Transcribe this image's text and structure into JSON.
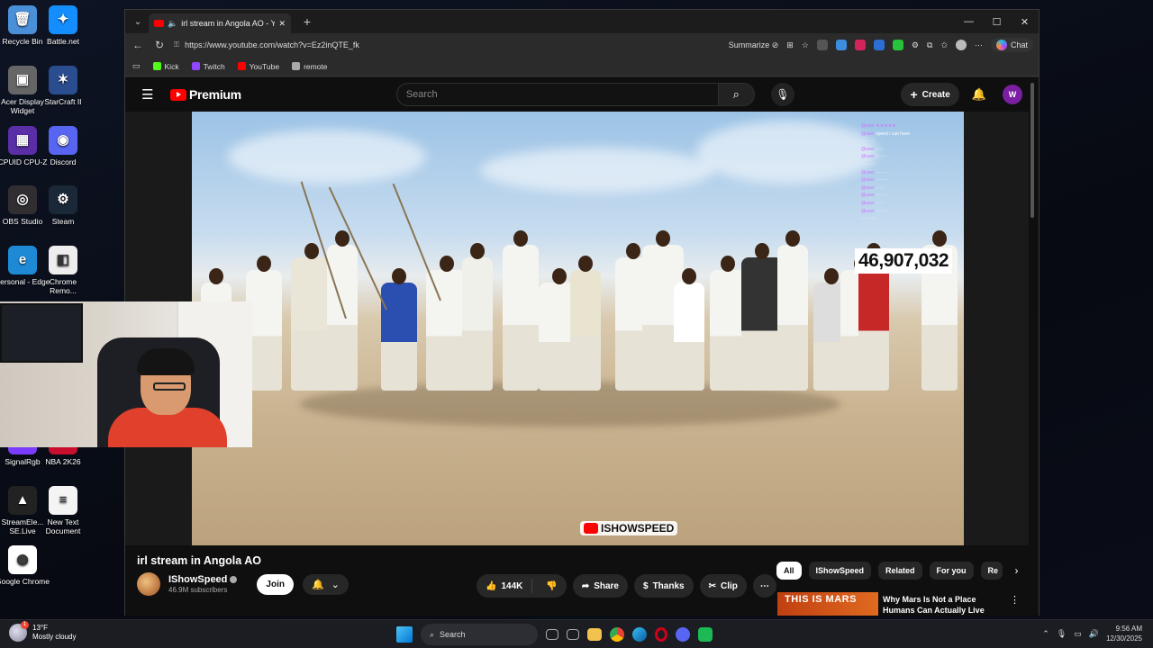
{
  "desktop": {
    "icons": [
      {
        "label": "Recycle Bin",
        "color": "#4a90d9",
        "glyph": "🗑"
      },
      {
        "label": "Battle.net",
        "color": "#148eff",
        "glyph": "✦"
      },
      {
        "label": "Acer Display Widget",
        "color": "#666",
        "glyph": "▣"
      },
      {
        "label": "StarCraft II",
        "color": "#2a4d8f",
        "glyph": "✶"
      },
      {
        "label": "CPUID CPU-Z",
        "color": "#5a2ea6",
        "glyph": "▦"
      },
      {
        "label": "Discord",
        "color": "#5865f2",
        "glyph": "◉"
      },
      {
        "label": "OBS Studio",
        "color": "#302e31",
        "glyph": "◎"
      },
      {
        "label": "Steam",
        "color": "#1b2838",
        "glyph": "⚙"
      },
      {
        "label": "Personal - Edge",
        "color": "#1e8ad6",
        "glyph": "e"
      },
      {
        "label": "Chrome Remo...",
        "color": "#eeeeee",
        "glyph": "◧"
      },
      {
        "label": "SignalRgb",
        "color": "#7a3cff",
        "glyph": "◆"
      },
      {
        "label": "NBA 2K26",
        "color": "#c8102e",
        "glyph": "2K"
      },
      {
        "label": "StreamEle... SE.Live",
        "color": "#222",
        "glyph": "▲"
      },
      {
        "label": "New Text Document",
        "color": "#f4f4f4",
        "glyph": "≡"
      },
      {
        "label": "Google Chrome",
        "color": "#ffffff",
        "glyph": "◍"
      }
    ]
  },
  "browser": {
    "tab_title": "irl stream in Angola AO - YouT",
    "url": "https://www.youtube.com/watch?v=Ez2inQTE_fk",
    "summarize_label": "Summarize",
    "chat_label": "Chat",
    "bookmarks": [
      {
        "label": "Kick",
        "color": "#53fc18"
      },
      {
        "label": "Twitch",
        "color": "#9146ff"
      },
      {
        "label": "YouTube",
        "color": "#ff0000"
      },
      {
        "label": "remote",
        "color": "#aaaaaa"
      }
    ]
  },
  "youtube": {
    "logo_text": "Premium",
    "search_placeholder": "Search",
    "create_label": "Create",
    "account_initial": "W",
    "video": {
      "title": "irl stream in Angola AO",
      "counter_text": "46,907,032",
      "watermark": "ISHOWSPEED"
    },
    "channel": {
      "name": "IShowSpeed",
      "subscribers": "46.9M subscribers",
      "join_label": "Join"
    },
    "actions": {
      "likes": "144K",
      "share": "Share",
      "thanks": "Thanks",
      "clip": "Clip"
    },
    "chips": [
      "All",
      "IShowSpeed",
      "Related",
      "For you",
      "Re"
    ],
    "recommendation": {
      "thumb_text": "THIS IS MARS",
      "title": "Why Mars Is Not a Place Humans Can Actually Live"
    }
  },
  "taskbar": {
    "weather_temp": "13°F",
    "weather_desc": "Mostly cloudy",
    "search_label": "Search",
    "time": "9:56 AM",
    "date": "12/30/2025"
  }
}
